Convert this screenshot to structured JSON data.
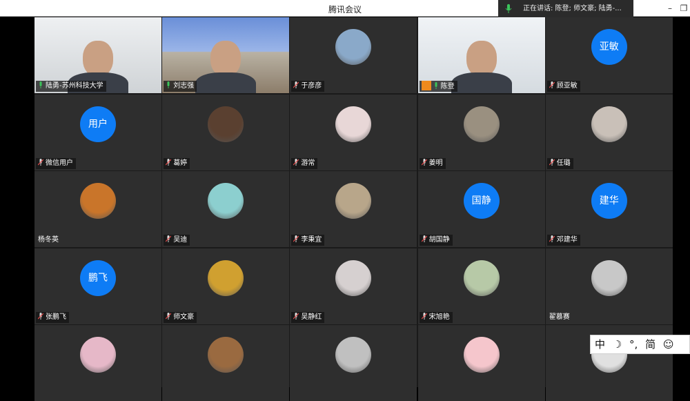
{
  "window": {
    "title": "腾讯会议",
    "speaking_label": "正在讲话: 陈登; 师文豪; 陆勇-..."
  },
  "colors": {
    "accent": "#0e7cf5",
    "mic_green": "#3bc45b",
    "mic_off": "#e54d4d"
  },
  "participants": [
    {
      "name": "陆勇-苏州科技大学",
      "type": "video",
      "mic": "on"
    },
    {
      "name": "刘志强",
      "type": "video",
      "mic": "on"
    },
    {
      "name": "于彦彦",
      "type": "photo",
      "mic": "off"
    },
    {
      "name": "陈登",
      "type": "video",
      "mic": "on",
      "host": true
    },
    {
      "name": "顾亚敏",
      "type": "text",
      "initials": "亚敏",
      "mic": "off"
    },
    {
      "name": "微信用户",
      "type": "text",
      "initials": "用户",
      "mic": "off"
    },
    {
      "name": "葛婷",
      "type": "photo",
      "mic": "off"
    },
    {
      "name": "游常",
      "type": "photo",
      "mic": "off"
    },
    {
      "name": "姜明",
      "type": "photo",
      "mic": "off"
    },
    {
      "name": "任璐",
      "type": "photo",
      "mic": "off"
    },
    {
      "name": "杨冬英",
      "type": "photo",
      "mic": "none"
    },
    {
      "name": "吴迪",
      "type": "photo",
      "mic": "off"
    },
    {
      "name": "李秉宜",
      "type": "photo",
      "mic": "off"
    },
    {
      "name": "胡国静",
      "type": "text",
      "initials": "国静",
      "mic": "off"
    },
    {
      "name": "邓建华",
      "type": "text",
      "initials": "建华",
      "mic": "off"
    },
    {
      "name": "张鹏飞",
      "type": "text",
      "initials": "鹏飞",
      "mic": "off"
    },
    {
      "name": "师文豪",
      "type": "photo",
      "mic": "off"
    },
    {
      "name": "吴静红",
      "type": "photo",
      "mic": "off"
    },
    {
      "name": "宋旭艳",
      "type": "photo",
      "mic": "off"
    },
    {
      "name": "翟慕赛",
      "type": "photo",
      "mic": "none"
    },
    {
      "name": "",
      "type": "photo",
      "mic": "none"
    },
    {
      "name": "",
      "type": "photo",
      "mic": "none"
    },
    {
      "name": "",
      "type": "photo",
      "mic": "none"
    },
    {
      "name": "",
      "type": "photo",
      "mic": "none"
    },
    {
      "name": "",
      "type": "photo",
      "mic": "none"
    }
  ],
  "photo_colors": [
    "#8aa9c9",
    "#5a4030",
    "#e8d7d7",
    "#9a9080",
    "#c9c0b8",
    "#c9752a",
    "#8ccfcf",
    "#b8a68a",
    "#d0a030",
    "#d6d0d0",
    "#b7c9a7",
    "#c8c8c8",
    "#e6b8c8",
    "#9a6a40",
    "#c0c0c0",
    "#f5c6cc",
    "#e0e0e0"
  ],
  "ime": {
    "items": [
      "中",
      "☽",
      "°,",
      "简",
      "☺"
    ]
  }
}
